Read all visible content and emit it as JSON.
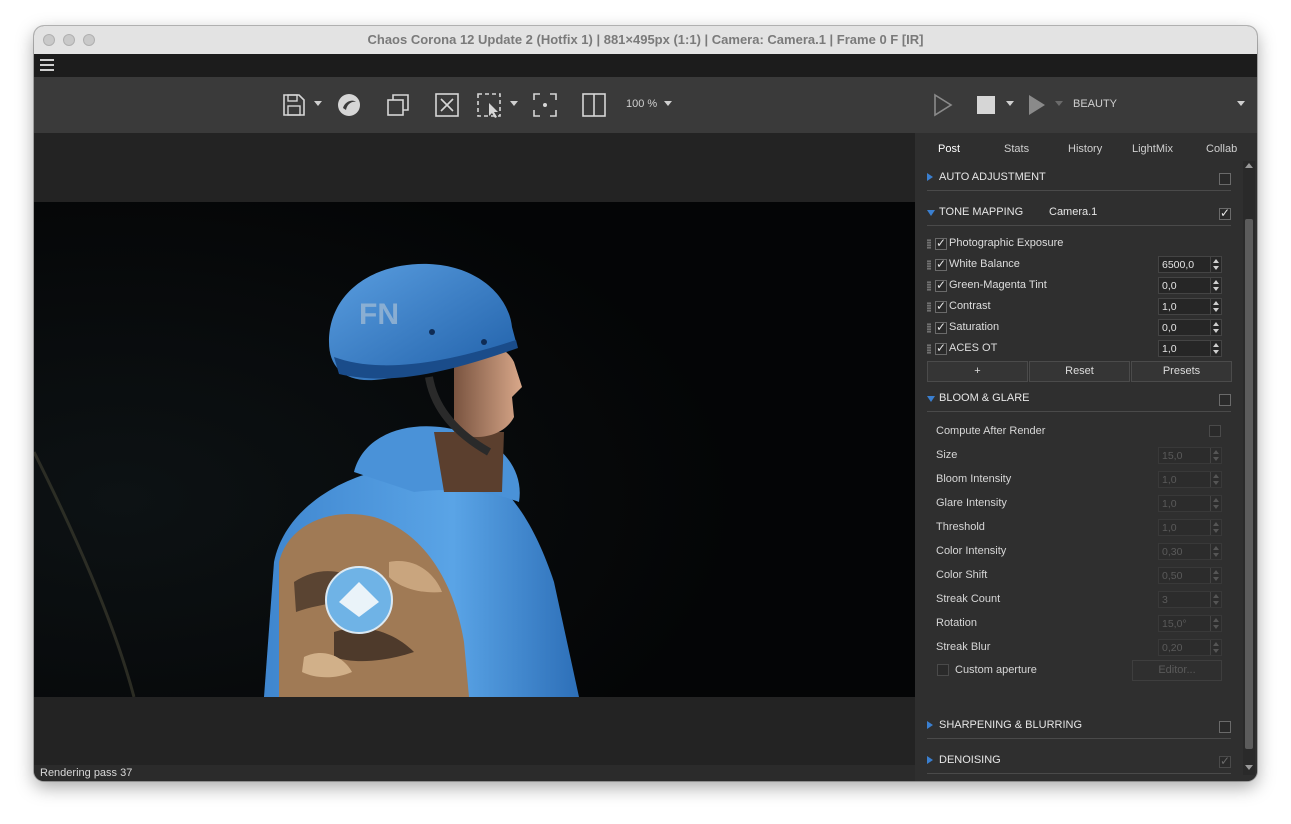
{
  "window": {
    "title": "Chaos Corona 12 Update 2 (Hotfix 1) | 881×495px (1:1) | Camera: Camera.1 | Frame 0 F [IR]"
  },
  "toolbar": {
    "icons": [
      "save-icon",
      "corona-logo-icon",
      "copy-icon",
      "clear-icon",
      "region-select-icon",
      "focus-icon",
      "compare-icon"
    ],
    "zoom_label": "100 %",
    "pass_label": "BEAUTY"
  },
  "status": {
    "text": "Rendering pass 37"
  },
  "panel": {
    "tabs": [
      "Post",
      "Stats",
      "History",
      "LightMix",
      "Collab"
    ],
    "active_tab": "Post",
    "auto_adjustment": {
      "title": "AUTO ADJUSTMENT",
      "enabled": false
    },
    "tone_mapping": {
      "title": "TONE MAPPING",
      "camera": "Camera.1",
      "enabled": true,
      "operators": [
        {
          "label": "Photographic Exposure",
          "value": null
        },
        {
          "label": "White Balance",
          "value": "6500,0"
        },
        {
          "label": "Green-Magenta Tint",
          "value": "0,0"
        },
        {
          "label": "Contrast",
          "value": "1,0"
        },
        {
          "label": "Saturation",
          "value": "0,0"
        },
        {
          "label": "ACES OT",
          "value": "1,0"
        }
      ],
      "buttons": {
        "add": "+",
        "reset": "Reset",
        "presets": "Presets"
      }
    },
    "bloom_glare": {
      "title": "BLOOM & GLARE",
      "enabled": false,
      "compute_after_render": "Compute After Render",
      "params": [
        {
          "label": "Size",
          "value": "15,0"
        },
        {
          "label": "Bloom Intensity",
          "value": "1,0"
        },
        {
          "label": "Glare Intensity",
          "value": "1,0"
        },
        {
          "label": "Threshold",
          "value": "1,0"
        },
        {
          "label": "Color Intensity",
          "value": "0,30"
        },
        {
          "label": "Color Shift",
          "value": "0,50"
        },
        {
          "label": "Streak Count",
          "value": "3"
        },
        {
          "label": "Rotation",
          "value": "15,0°"
        },
        {
          "label": "Streak Blur",
          "value": "0,20"
        }
      ],
      "custom_aperture": "Custom aperture",
      "editor_button": "Editor..."
    },
    "sharpening": {
      "title": "SHARPENING & BLURRING",
      "enabled": false
    },
    "denoising": {
      "title": "DENOISING",
      "enabled": true
    }
  },
  "colors": {
    "accent": "#3a7fd0",
    "panel_bg": "#2f2f2f",
    "toolbar_bg": "#3a3a3a"
  }
}
